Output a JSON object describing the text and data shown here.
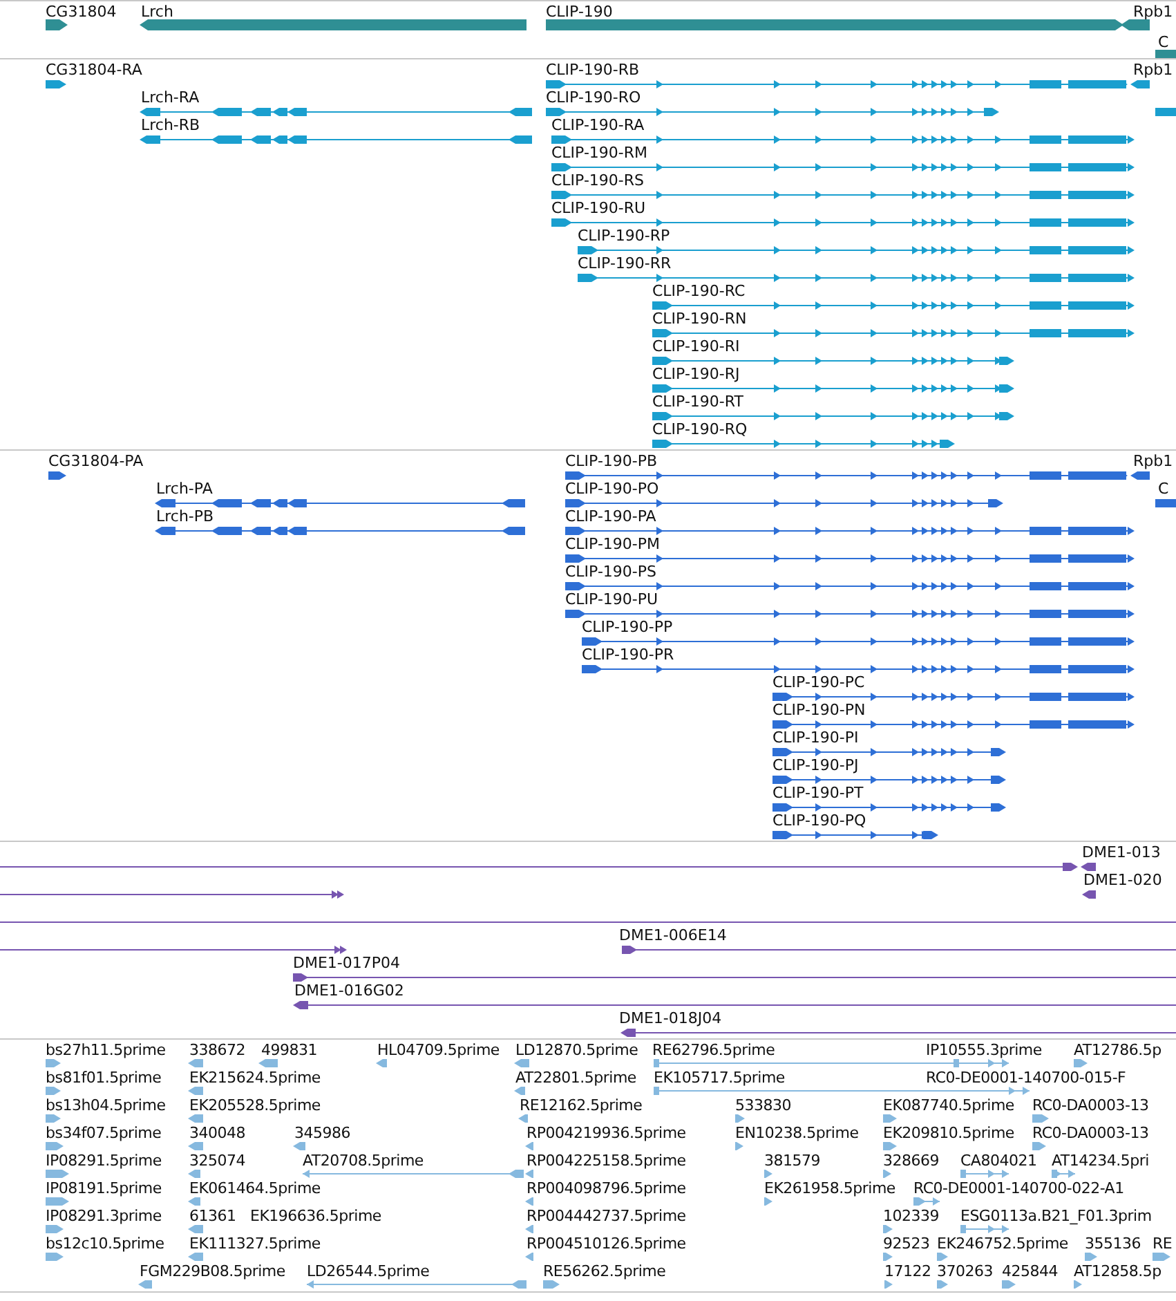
{
  "tracks": [
    {
      "kind": "gene",
      "color": "#2f8f94",
      "lanes": [
        {
          "features": [
            {
              "label": "CG31804",
              "reverse": false
            },
            {
              "label": "Lrch",
              "reverse": true
            },
            {
              "label": "CLIP-190",
              "reverse": false
            },
            {
              "label": "Rpb1",
              "reverse": true
            }
          ]
        },
        {
          "features": [
            {
              "label": "C"
            }
          ]
        }
      ]
    },
    {
      "kind": "transcript",
      "color": "#1a9fcf",
      "lanes": [
        {
          "features": [
            {
              "label": "CG31804-RA",
              "reverse": false
            },
            {
              "label": "CLIP-190-RB",
              "reverse": false
            },
            {
              "label": "Rpb1",
              "reverse": true
            }
          ]
        },
        {
          "features": [
            {
              "label": "Lrch-RA",
              "reverse": true
            },
            {
              "label": "CLIP-190-RO",
              "reverse": false
            },
            {
              "kind": "block"
            }
          ]
        },
        {
          "features": [
            {
              "label": "Lrch-RB",
              "reverse": true
            },
            {
              "label": "CLIP-190-RA",
              "reverse": false
            }
          ]
        },
        {
          "features": [
            {
              "label": "CLIP-190-RM",
              "reverse": false
            }
          ]
        },
        {
          "features": [
            {
              "label": "CLIP-190-RS",
              "reverse": false
            }
          ]
        },
        {
          "features": [
            {
              "label": "CLIP-190-RU",
              "reverse": false
            }
          ]
        },
        {
          "features": [
            {
              "label": "CLIP-190-RP",
              "reverse": false
            }
          ]
        },
        {
          "features": [
            {
              "label": "CLIP-190-RR",
              "reverse": false
            }
          ]
        },
        {
          "features": [
            {
              "label": "CLIP-190-RC",
              "reverse": false
            }
          ]
        },
        {
          "features": [
            {
              "label": "CLIP-190-RN",
              "reverse": false
            }
          ]
        },
        {
          "features": [
            {
              "label": "CLIP-190-RI",
              "reverse": false
            }
          ]
        },
        {
          "features": [
            {
              "label": "CLIP-190-RJ",
              "reverse": false
            }
          ]
        },
        {
          "features": [
            {
              "label": "CLIP-190-RT",
              "reverse": false
            }
          ]
        },
        {
          "features": [
            {
              "label": "CLIP-190-RQ",
              "reverse": false
            }
          ]
        }
      ]
    },
    {
      "kind": "polypeptide",
      "color": "#2e6fd6",
      "lanes": [
        {
          "features": [
            {
              "label": "CG31804-PA",
              "reverse": false
            },
            {
              "label": "CLIP-190-PB",
              "reverse": false
            },
            {
              "label": "Rpb1",
              "reverse": true
            }
          ]
        },
        {
          "features": [
            {
              "label": "Lrch-PA",
              "reverse": true
            },
            {
              "label": "CLIP-190-PO",
              "reverse": false
            },
            {
              "label": "C"
            }
          ]
        },
        {
          "features": [
            {
              "label": "Lrch-PB",
              "reverse": true
            },
            {
              "label": "CLIP-190-PA",
              "reverse": false
            }
          ]
        },
        {
          "features": [
            {
              "label": "CLIP-190-PM",
              "reverse": false
            }
          ]
        },
        {
          "features": [
            {
              "label": "CLIP-190-PS",
              "reverse": false
            }
          ]
        },
        {
          "features": [
            {
              "label": "CLIP-190-PU",
              "reverse": false
            }
          ]
        },
        {
          "features": [
            {
              "label": "CLIP-190-PP",
              "reverse": false
            }
          ]
        },
        {
          "features": [
            {
              "label": "CLIP-190-PR",
              "reverse": false
            }
          ]
        },
        {
          "features": [
            {
              "label": "CLIP-190-PC",
              "reverse": false
            }
          ]
        },
        {
          "features": [
            {
              "label": "CLIP-190-PN",
              "reverse": false
            }
          ]
        },
        {
          "features": [
            {
              "label": "CLIP-190-PI",
              "reverse": false
            }
          ]
        },
        {
          "features": [
            {
              "label": "CLIP-190-PJ",
              "reverse": false
            }
          ]
        },
        {
          "features": [
            {
              "label": "CLIP-190-PT",
              "reverse": false
            }
          ]
        },
        {
          "features": [
            {
              "label": "CLIP-190-PQ",
              "reverse": false
            }
          ]
        }
      ]
    },
    {
      "kind": "clone",
      "color": "#7755b0",
      "lanes": [
        {
          "features": [
            {
              "reverse": false
            },
            {
              "label": "DME1-013",
              "reverse": true
            }
          ]
        },
        {
          "features": [
            {
              "reverse": false
            },
            {
              "label": "DME1-020",
              "reverse": true
            }
          ]
        },
        {
          "features": [
            {
              "kind": "span"
            }
          ]
        },
        {
          "features": [
            {
              "reverse": false
            },
            {
              "label": "DME1-006E14",
              "reverse": false
            }
          ]
        },
        {
          "features": [
            {
              "label": "DME1-017P04",
              "reverse": false
            }
          ]
        },
        {
          "features": [
            {
              "label": "DME1-016G02",
              "reverse": true
            }
          ]
        },
        {
          "features": [
            {
              "label": "DME1-018J04",
              "reverse": true
            }
          ]
        }
      ]
    },
    {
      "kind": "est",
      "color": "#86b9df",
      "lanes": [
        {
          "features": [
            {
              "label": "bs27h11.5prime",
              "reverse": false
            },
            {
              "label": "338672",
              "reverse": true
            },
            {
              "label": "499831",
              "reverse": true
            },
            {
              "label": "HL04709.5prime",
              "reverse": true
            },
            {
              "label": "LD12870.5prime",
              "reverse": true
            },
            {
              "label": "RE62796.5prime",
              "reverse": false
            },
            {
              "label": "IP10555.3prime",
              "reverse": false
            },
            {
              "label": "AT12786.5p",
              "reverse": false
            }
          ]
        },
        {
          "features": [
            {
              "label": "bs81f01.5prime",
              "reverse": false
            },
            {
              "label": "EK215624.5prime",
              "reverse": true
            },
            {
              "label": "AT22801.5prime",
              "reverse": true
            },
            {
              "label": "EK105717.5prime",
              "reverse": false
            },
            {
              "label": "RC0-DE0001-140700-015-F"
            }
          ]
        },
        {
          "features": [
            {
              "label": "bs13h04.5prime",
              "reverse": false
            },
            {
              "label": "EK205528.5prime",
              "reverse": true
            },
            {
              "label": "RE12162.5prime",
              "reverse": true
            },
            {
              "label": "533830",
              "reverse": false
            },
            {
              "label": "EK087740.5prime",
              "reverse": false
            },
            {
              "label": "RC0-DA0003-13",
              "reverse": false
            }
          ]
        },
        {
          "features": [
            {
              "label": "bs34f07.5prime",
              "reverse": false
            },
            {
              "label": "340048",
              "reverse": true
            },
            {
              "label": "345986",
              "reverse": true
            },
            {
              "label": "RP004219936.5prime",
              "reverse": true
            },
            {
              "label": "EN10238.5prime",
              "reverse": false
            },
            {
              "label": "EK209810.5prime",
              "reverse": false
            },
            {
              "label": "RC0-DA0003-13",
              "reverse": false
            }
          ]
        },
        {
          "features": [
            {
              "label": "IP08291.5prime",
              "reverse": false
            },
            {
              "label": "325074",
              "reverse": true
            },
            {
              "label": "AT20708.5prime",
              "reverse": true
            },
            {
              "label": "RP004225158.5prime",
              "reverse": true
            },
            {
              "label": "381579",
              "reverse": false
            },
            {
              "label": "328669",
              "reverse": false
            },
            {
              "label": "CA804021",
              "reverse": false
            },
            {
              "label": "AT14234.5pri",
              "reverse": false
            }
          ]
        },
        {
          "features": [
            {
              "label": "IP08191.5prime",
              "reverse": false
            },
            {
              "label": "EK061464.5prime",
              "reverse": true
            },
            {
              "label": "RP004098796.5prime",
              "reverse": true
            },
            {
              "label": "EK261958.5prime",
              "reverse": false
            },
            {
              "label": "RC0-DE0001-140700-022-A1",
              "reverse": false
            }
          ]
        },
        {
          "features": [
            {
              "label": "IP08291.3prime",
              "reverse": false
            },
            {
              "label": "61361",
              "reverse": true
            },
            {
              "label": "EK196636.5prime"
            },
            {
              "label": "RP004442737.5prime",
              "reverse": true
            },
            {
              "label": "102339",
              "reverse": false
            },
            {
              "label": "ESG0113a.B21_F01.3prim",
              "reverse": false
            }
          ]
        },
        {
          "features": [
            {
              "label": "bs12c10.5prime",
              "reverse": false
            },
            {
              "label": "EK111327.5prime",
              "reverse": true
            },
            {
              "label": "RP004510126.5prime",
              "reverse": true
            },
            {
              "label": "92523",
              "reverse": false
            },
            {
              "label": "EK246752.5prime",
              "reverse": false
            },
            {
              "label": "355136",
              "reverse": false
            },
            {
              "label": "RE",
              "reverse": false
            }
          ]
        },
        {
          "features": [
            {
              "label": "FGM229B08.5prime",
              "reverse": true
            },
            {
              "label": "LD26544.5prime",
              "reverse": true
            },
            {
              "label": "RE56262.5prime",
              "reverse": false
            },
            {
              "label": "17122",
              "reverse": false
            },
            {
              "label": "370263",
              "reverse": false
            },
            {
              "label": "425844",
              "reverse": false
            },
            {
              "label": "AT12858.5p",
              "reverse": false
            }
          ]
        }
      ]
    }
  ]
}
